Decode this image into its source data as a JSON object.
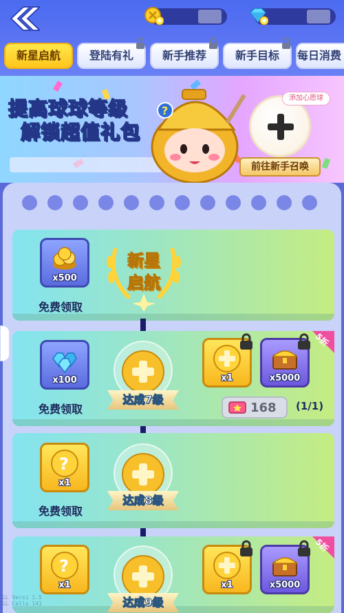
{
  "header": {
    "coin_amount": "",
    "gem_amount": ""
  },
  "tabs": [
    {
      "label": "新星启航",
      "active": true
    },
    {
      "label": "登陆有礼",
      "locked": true
    },
    {
      "label": "新手推荐",
      "locked": true
    },
    {
      "label": "新手目标",
      "locked": true
    },
    {
      "label": "每日消费",
      "locked": false
    }
  ],
  "banner": {
    "title_line1": "提高球球等级",
    "title_line2_pre": "解锁",
    "title_line2_hl": "超值",
    "title_line2_post": "礼包",
    "summon_tag": "添加心愿球",
    "summon_button": "前往新手召唤"
  },
  "rows": [
    {
      "badge_line1": "新星",
      "badge_line2": "启航",
      "free_item": {
        "qty": "x500",
        "icon": "gold-coins-icon"
      },
      "free_label": "免费领取"
    },
    {
      "level": "达成7级",
      "free_item": {
        "qty": "x100",
        "icon": "diamonds-icon"
      },
      "free_label": "免费领取",
      "paid_items": [
        {
          "qty": "x1",
          "icon": "golden-ball-icon"
        },
        {
          "qty": "x5000",
          "icon": "treasure-chest-icon"
        }
      ],
      "discount": "5折",
      "price": "168",
      "purchase_count": "(1/1)"
    },
    {
      "level": "达成8级",
      "free_item": {
        "qty": "x1",
        "icon": "mystery-ball-icon"
      },
      "free_label": "免费领取"
    },
    {
      "level": "达成9级",
      "free_item": {
        "qty": "x1",
        "icon": "mystery-ball-icon"
      },
      "paid_items": [
        {
          "qty": "x1",
          "icon": "golden-ball-icon"
        },
        {
          "qty": "x5000",
          "icon": "treasure-chest-icon"
        }
      ],
      "discount": "5折"
    }
  ],
  "debug": {
    "line1": "GL Versi  1.5",
    "line2": "GL Calls  141"
  },
  "colors": {
    "header_bg": "#4b6bf0",
    "tab_active": "#ffc61c",
    "row_gradient_start": "#84e4f0",
    "row_gradient_end": "#c5ec82",
    "track": "#1a1c6a",
    "discount_pink": "#f04fa0"
  }
}
